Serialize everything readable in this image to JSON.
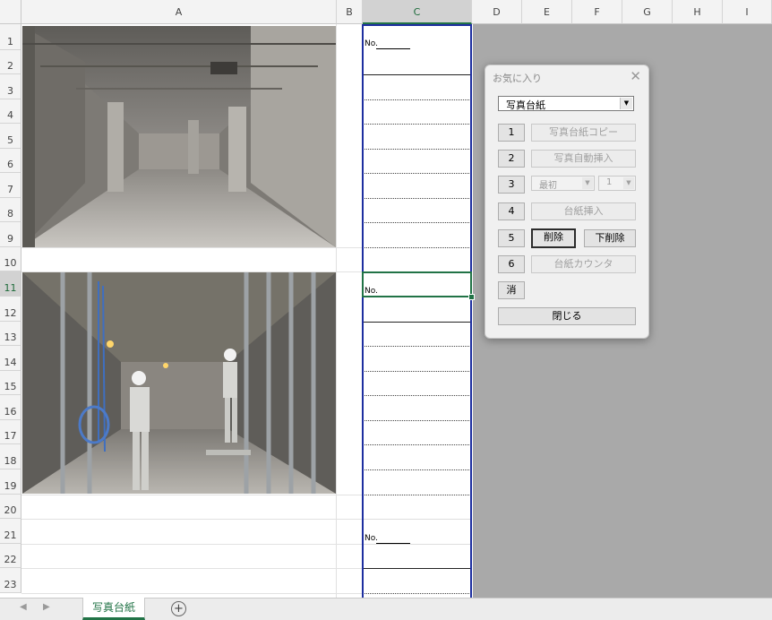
{
  "columns": [
    "A",
    "B",
    "C",
    "D",
    "E",
    "F",
    "G",
    "H",
    "I"
  ],
  "rows": [
    "1",
    "2",
    "3",
    "4",
    "5",
    "6",
    "7",
    "8",
    "9",
    "10",
    "11",
    "12",
    "13",
    "14",
    "15",
    "16",
    "17",
    "18",
    "19",
    "20",
    "21",
    "22",
    "23"
  ],
  "selected_column": "C",
  "selected_row": "11",
  "no_label": "No.",
  "sheet_tab": "写真台紙",
  "dialog": {
    "title": "お気に入り",
    "close_glyph": "✕",
    "combo_value": "写真台紙",
    "buttons": {
      "b1": "1",
      "b2": "2",
      "b3": "3",
      "b4": "4",
      "b5": "5",
      "b6": "6",
      "clear": "消",
      "copy": "写真台紙コピー",
      "autoinsert": "写真自動挿入",
      "first_combo": "最初",
      "num_combo": "1",
      "insert": "台紙挿入",
      "delete": "削除",
      "delete_below": "下削除",
      "counter": "台紙カウンタ",
      "close": "閉じる"
    }
  },
  "colors": {
    "accent": "#217346",
    "border_blue": "#1e2fa0",
    "gray_area": "#a9a9a9"
  }
}
